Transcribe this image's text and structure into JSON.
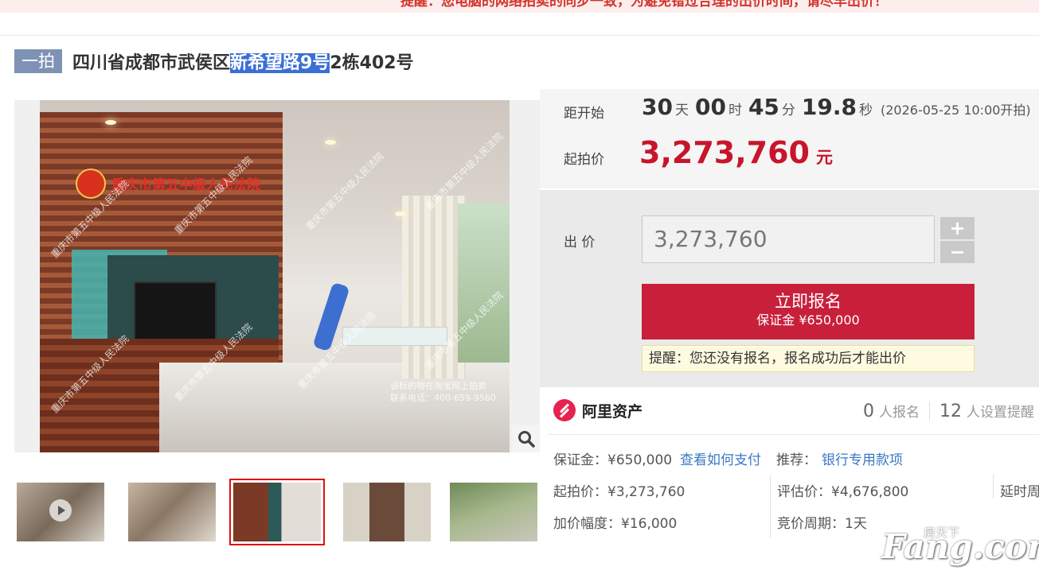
{
  "banner": {
    "text": "提醒：您电脑的网络拍卖的同步一致，为避免错过合理的出价时间，请尽早出价！"
  },
  "header": {
    "round_tag": "一拍",
    "title_prefix": "四川省成都市武侯区",
    "title_highlight": "新希望路9号",
    "title_suffix": "2栋402号"
  },
  "gallery": {
    "court_watermark": "重庆市第五中级人民法院",
    "watermark_text": "重庆市第五中级人民法院",
    "contact_line1": "该标的物在淘宝网上拍卖",
    "contact_line2": "联系电话：400-659-9560",
    "zoom_icon": "magnifier-icon",
    "thumbnails": [
      {
        "label": "video-thumb",
        "has_play": true
      },
      {
        "label": "kitchen-thumb"
      },
      {
        "label": "living-room-thumb",
        "selected": true
      },
      {
        "label": "door-thumb"
      },
      {
        "label": "street-thumb"
      }
    ]
  },
  "countdown": {
    "label": "距开始",
    "days": "30",
    "days_unit": "天",
    "hours": "00",
    "hours_unit": "时",
    "minutes": "45",
    "minutes_unit": "分",
    "seconds": "19.8",
    "seconds_unit": "秒",
    "start_time": "(2026-05-25 10:00开拍)"
  },
  "starting_price": {
    "label": "起拍价",
    "value": "3,273,760",
    "unit": "元"
  },
  "bid": {
    "label": "出 价",
    "input_value": "3,273,760",
    "plus": "+",
    "minus": "−",
    "signup_label": "立即报名",
    "deposit_label": "保证金 ¥650,000",
    "reminder": "提醒：您还没有报名，报名成功后才能出价"
  },
  "platform": {
    "name": "阿里资产",
    "signup_count": "0",
    "signup_label": "人报名",
    "reminder_count": "12",
    "reminder_label": "人设置提醒"
  },
  "details": {
    "deposit": "保证金：¥650,000",
    "how_to_pay": "查看如何支付",
    "recommend_label": "推荐：",
    "recommend_link": "银行专用款项",
    "start_price": "起拍价：¥3,273,760",
    "appraisal": "评估价：¥4,676,800",
    "delay": "延时周期",
    "increment": "加价幅度：¥16,000",
    "cycle": "竞价周期：1天"
  },
  "watermark": {
    "brand": "Fang.com",
    "sub": "房天下"
  },
  "colors": {
    "price_red": "#c8152b",
    "button_red": "#c8203b",
    "link_blue": "#3a78c4",
    "tag_blue": "#7e92b5"
  }
}
